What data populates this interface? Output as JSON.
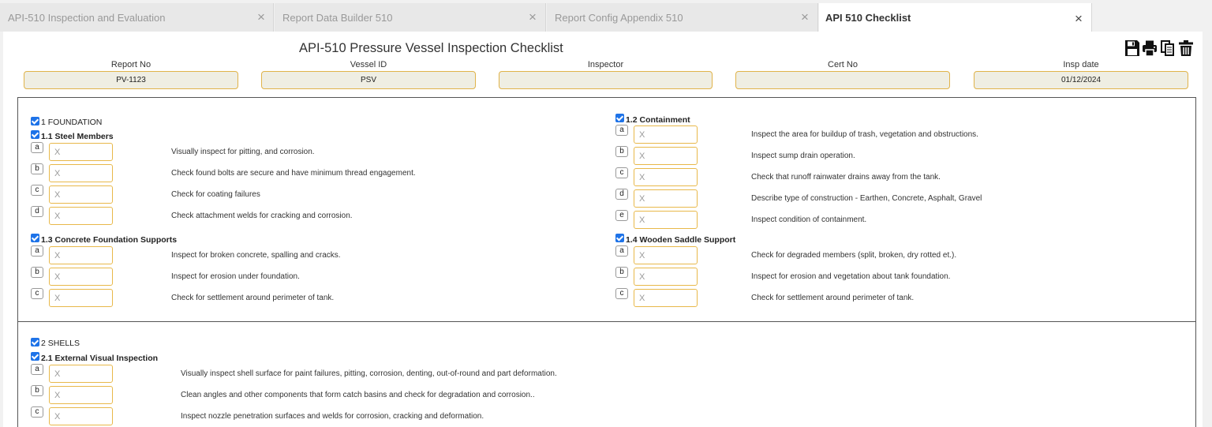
{
  "tabs": [
    {
      "label": "API-510 Inspection and Evaluation",
      "close": "×"
    },
    {
      "label": "Report Data Builder 510",
      "close": "×"
    },
    {
      "label": "Report Config Appendix 510",
      "close": "×"
    },
    {
      "label": "API 510 Checklist",
      "close": "×"
    }
  ],
  "page": {
    "title": "API-510 Pressure Vessel Inspection Checklist",
    "toolbar": [
      "save-icon",
      "print-icon",
      "copy-icon",
      "delete-icon"
    ]
  },
  "header_fields": [
    {
      "label": "Report No",
      "value": "PV-1123"
    },
    {
      "label": "Vessel ID",
      "value": "PSV"
    },
    {
      "label": "Inspector",
      "value": ""
    },
    {
      "label": "Cert No",
      "value": ""
    },
    {
      "label": "Insp date",
      "value": "01/12/2024"
    }
  ],
  "section1": {
    "title": "1 FOUNDATION",
    "steel": {
      "title": "1.1 Steel Members",
      "items": [
        {
          "letter": "a",
          "value": "X",
          "desc": "Visually inspect for pitting, and corrosion."
        },
        {
          "letter": "b",
          "value": "X",
          "desc": "Check found bolts are secure and have minimum thread engagement."
        },
        {
          "letter": "c",
          "value": "X",
          "desc": "Check for coating failures"
        },
        {
          "letter": "d",
          "value": "X",
          "desc": "Check attachment welds for cracking and corrosion."
        }
      ]
    },
    "containment": {
      "title": "1.2 Containment",
      "items": [
        {
          "letter": "a",
          "value": "X",
          "desc": "Inspect the area for buildup of trash, vegetation and obstructions."
        },
        {
          "letter": "b",
          "value": "X",
          "desc": "Inspect sump drain operation."
        },
        {
          "letter": "c",
          "value": "X",
          "desc": "Check that runoff rainwater drains away from the tank."
        },
        {
          "letter": "d",
          "value": "X",
          "desc": "Describe type of construction - Earthen, Concrete, Asphalt, Gravel"
        },
        {
          "letter": "e",
          "value": "X",
          "desc": "Inspect condition of containment."
        }
      ]
    },
    "concrete": {
      "title": "1.3 Concrete Foundation Supports",
      "items": [
        {
          "letter": "a",
          "value": "X",
          "desc": "Inspect for broken concrete, spalling and cracks."
        },
        {
          "letter": "b",
          "value": "X",
          "desc": "Inspect for erosion under foundation."
        },
        {
          "letter": "c",
          "value": "X",
          "desc": "Check for settlement around perimeter of tank."
        }
      ]
    },
    "wooden": {
      "title": "1.4 Wooden Saddle Support",
      "items": [
        {
          "letter": "a",
          "value": "X",
          "desc": "Check for degraded members (split, broken, dry rotted et.)."
        },
        {
          "letter": "b",
          "value": "X",
          "desc": "Inspect for erosion and vegetation about tank foundation."
        },
        {
          "letter": "c",
          "value": "X",
          "desc": "Check for settlement around perimeter of tank."
        }
      ]
    }
  },
  "section2": {
    "title": "2 SHELLS",
    "external": {
      "title": "2.1 External Visual Inspection",
      "items": [
        {
          "letter": "a",
          "value": "X",
          "desc": "Visually inspect shell surface for paint failures, pitting, corrosion, denting, out-of-round and part deformation."
        },
        {
          "letter": "b",
          "value": "X",
          "desc": "Clean angles and other components that form catch basins and check for degradation and corrosion.."
        },
        {
          "letter": "c",
          "value": "X",
          "desc": "Inspect nozzle penetration surfaces and welds for corrosion, cracking and deformation."
        }
      ]
    }
  },
  "colors": {
    "accent": "#1e73e8",
    "field_border": "#e0b34a",
    "field_bg": "#efeee3"
  }
}
